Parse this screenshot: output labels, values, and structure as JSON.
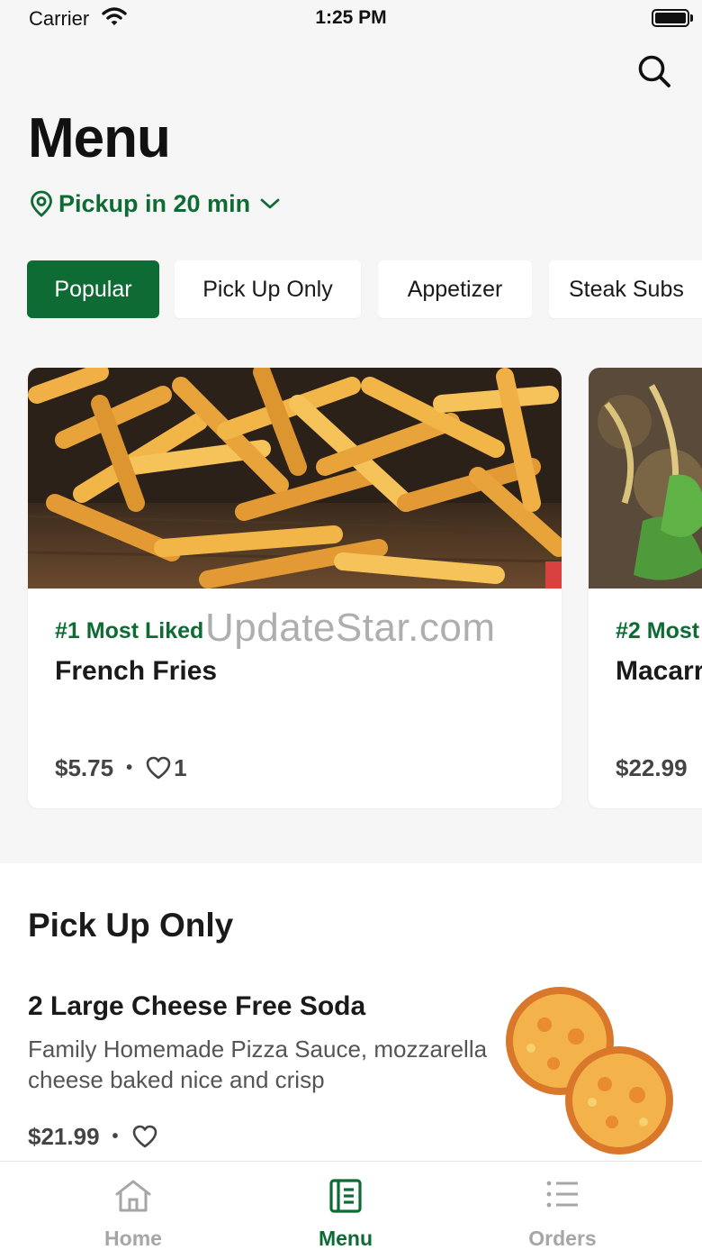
{
  "status_bar": {
    "carrier": "Carrier",
    "time": "1:25 PM"
  },
  "header": {
    "title": "Menu",
    "pickup": "Pickup in 20 min",
    "search_icon": "search-icon"
  },
  "categories": [
    "Popular",
    "Pick Up Only",
    "Appetizer",
    "Steak Subs"
  ],
  "selected_category": "Popular",
  "popular_items": [
    {
      "rank": "#1 Most Liked",
      "name": "French Fries",
      "price": "$5.75",
      "likes": "1"
    },
    {
      "rank": "#2 Most",
      "name": "Macarr",
      "price": "$22.99"
    }
  ],
  "watermark": "UpdateStar.com",
  "pickup_only_section": {
    "title": "Pick Up Only",
    "items": [
      {
        "name": "2 Large Cheese Free Soda",
        "description": "Family Homemade Pizza Sauce, mozzarella cheese baked nice and crisp",
        "price": "$21.99"
      }
    ]
  },
  "tab_bar": [
    {
      "label": "Home",
      "icon": "home-icon"
    },
    {
      "label": "Menu",
      "icon": "menu-book-icon"
    },
    {
      "label": "Orders",
      "icon": "list-icon"
    }
  ],
  "active_tab": "Menu",
  "colors": {
    "accent": "#0e6b34",
    "background": "#f6f6f6",
    "card": "#ffffff",
    "inactive_tab": "#a6a6a6"
  }
}
